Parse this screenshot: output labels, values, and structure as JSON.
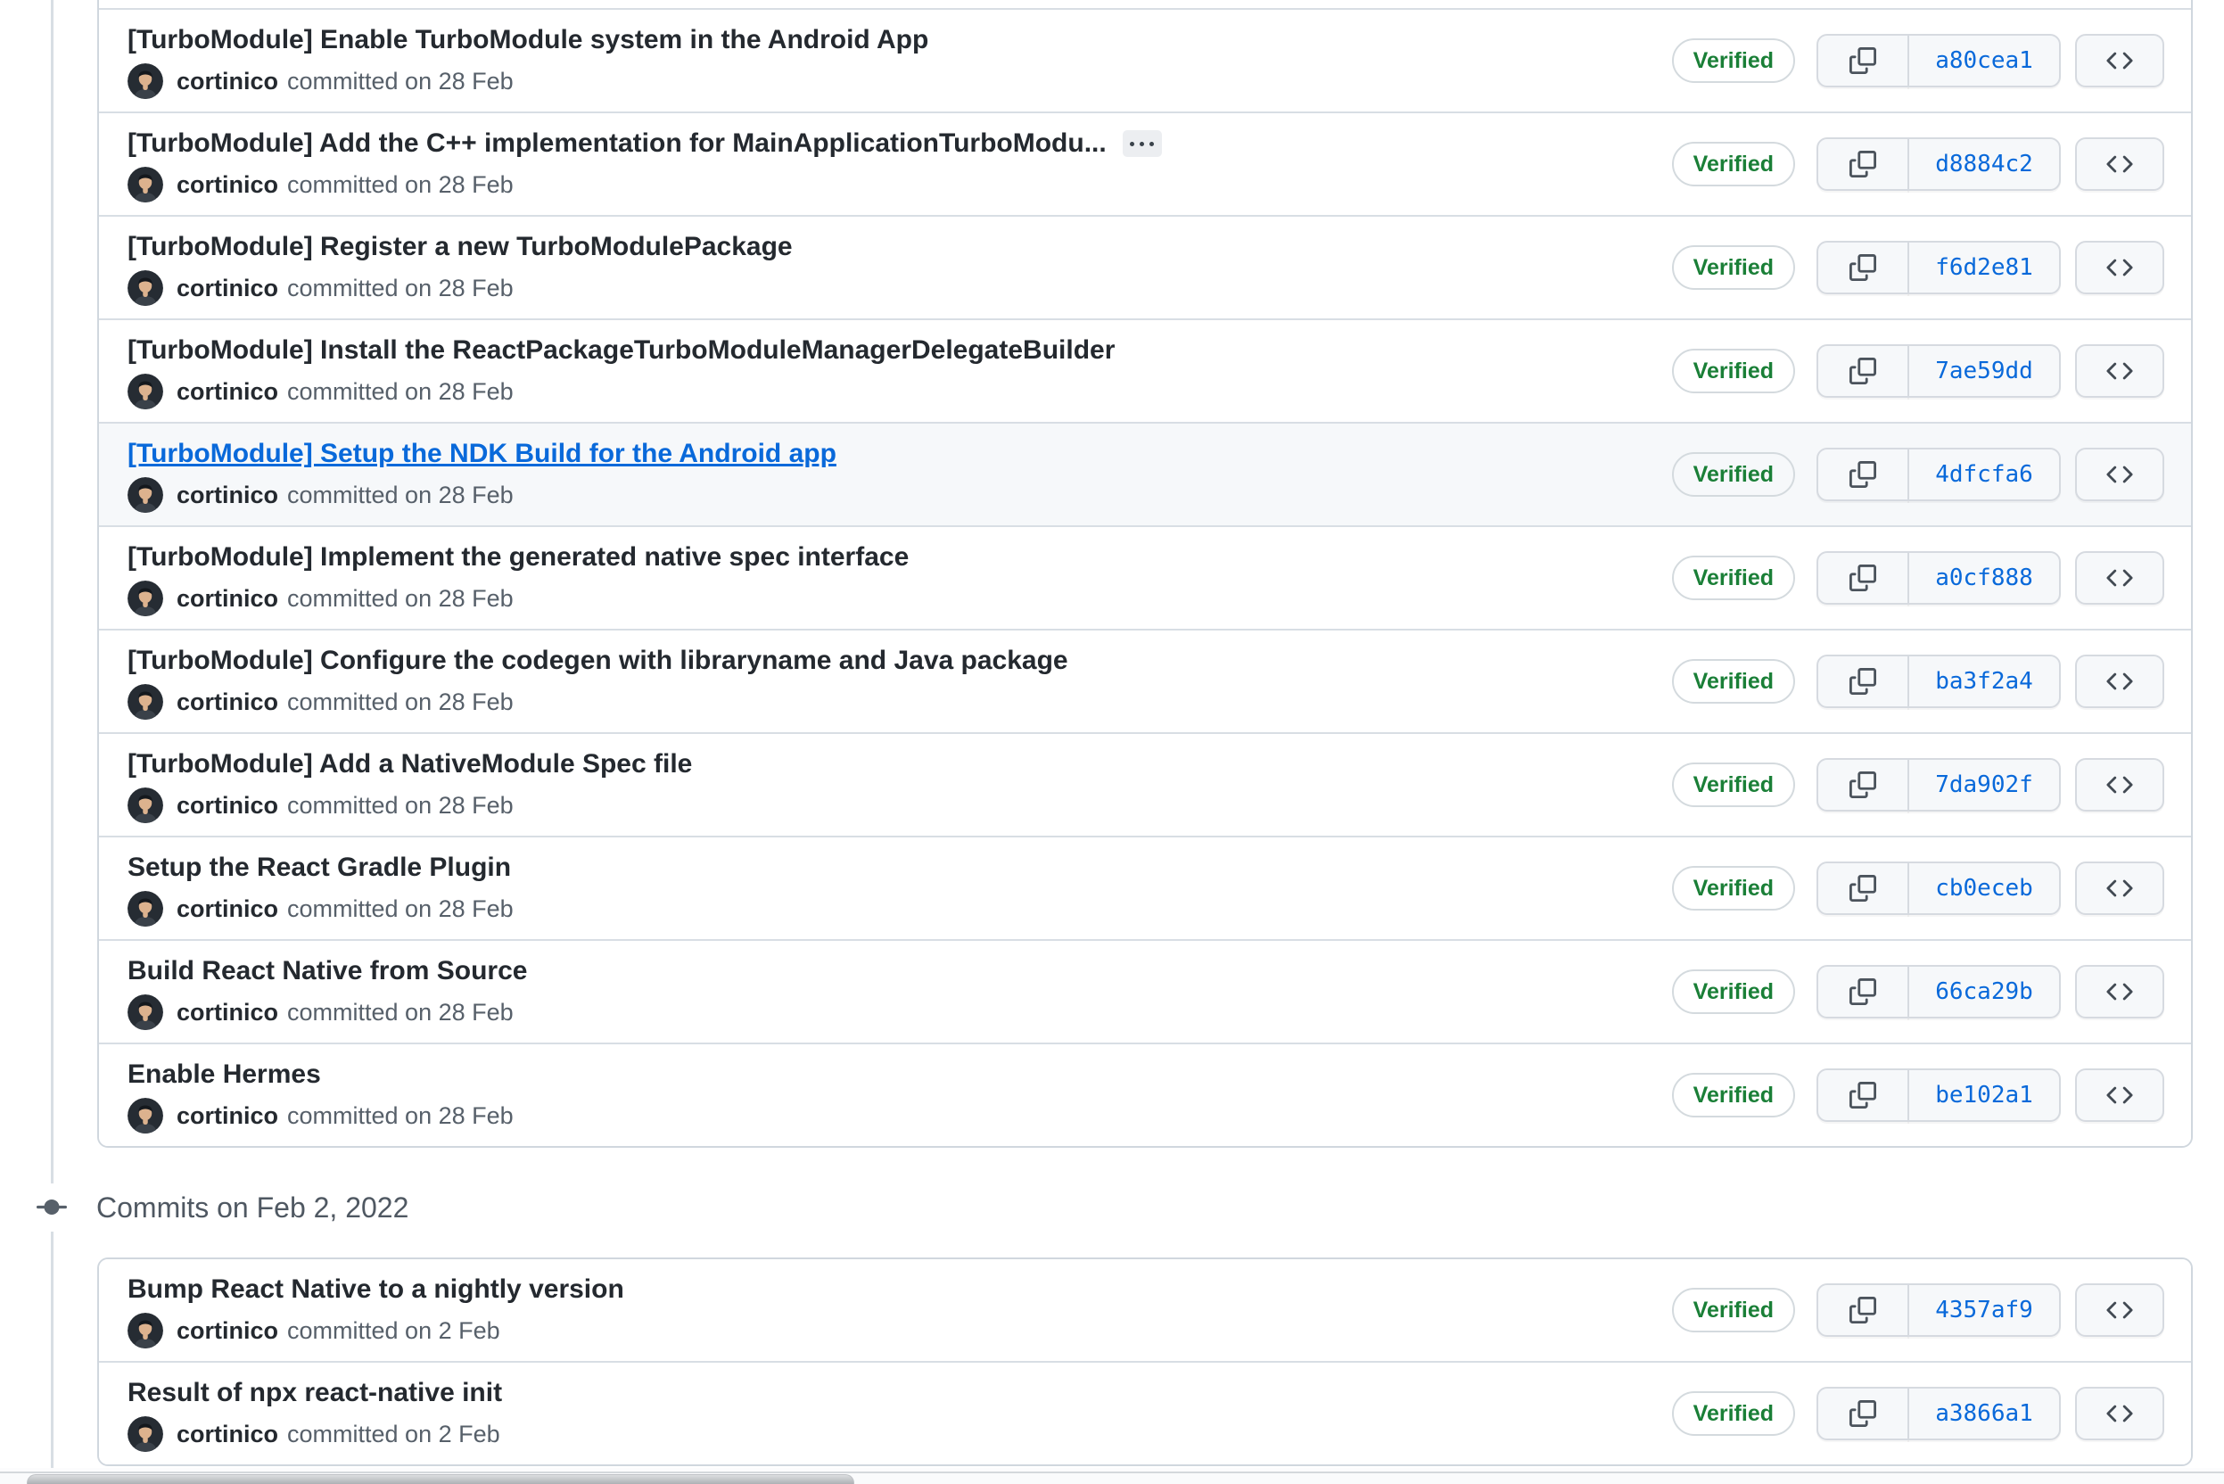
{
  "theme": {
    "link_blue": "#0969da",
    "verified_green": "#1a7f37",
    "text": "#24292f",
    "muted_text": "#57606a",
    "card_border": "#d0d7de",
    "row_highlight_bg": "#f6f8fa",
    "button_bg": "#f6f8fa"
  },
  "icons": {
    "copy": "copy-icon",
    "code": "code-icon",
    "git_commit": "git-commit-icon",
    "kebab": "kebab-horizontal-icon",
    "avatar": "user-avatar"
  },
  "scrollbar": {
    "orientation": "horizontal"
  },
  "groups": [
    {
      "heading": null,
      "commits": [
        {
          "title": "[TurboModule] Enable TurboModule system in the Android App",
          "author": "cortinico",
          "meta": "committed on 28 Feb",
          "hash": "a80cea1",
          "badge": "Verified",
          "truncated": false,
          "highlighted": false
        },
        {
          "title": "[TurboModule] Add the C++ implementation for MainApplicationTurboModu...",
          "author": "cortinico",
          "meta": "committed on 28 Feb",
          "hash": "d8884c2",
          "badge": "Verified",
          "truncated": true,
          "highlighted": false
        },
        {
          "title": "[TurboModule] Register a new TurboModulePackage",
          "author": "cortinico",
          "meta": "committed on 28 Feb",
          "hash": "f6d2e81",
          "badge": "Verified",
          "truncated": false,
          "highlighted": false
        },
        {
          "title": "[TurboModule] Install the ReactPackageTurboModuleManagerDelegateBuilder",
          "author": "cortinico",
          "meta": "committed on 28 Feb",
          "hash": "7ae59dd",
          "badge": "Verified",
          "truncated": false,
          "highlighted": false
        },
        {
          "title": "[TurboModule] Setup the NDK Build for the Android app",
          "author": "cortinico",
          "meta": "committed on 28 Feb",
          "hash": "4dfcfa6",
          "badge": "Verified",
          "truncated": false,
          "highlighted": true
        },
        {
          "title": "[TurboModule] Implement the generated native spec interface",
          "author": "cortinico",
          "meta": "committed on 28 Feb",
          "hash": "a0cf888",
          "badge": "Verified",
          "truncated": false,
          "highlighted": false
        },
        {
          "title": "[TurboModule] Configure the codegen with libraryname and Java package",
          "author": "cortinico",
          "meta": "committed on 28 Feb",
          "hash": "ba3f2a4",
          "badge": "Verified",
          "truncated": false,
          "highlighted": false
        },
        {
          "title": "[TurboModule] Add a NativeModule Spec file",
          "author": "cortinico",
          "meta": "committed on 28 Feb",
          "hash": "7da902f",
          "badge": "Verified",
          "truncated": false,
          "highlighted": false
        },
        {
          "title": "Setup the React Gradle Plugin",
          "author": "cortinico",
          "meta": "committed on 28 Feb",
          "hash": "cb0eceb",
          "badge": "Verified",
          "truncated": false,
          "highlighted": false
        },
        {
          "title": "Build React Native from Source",
          "author": "cortinico",
          "meta": "committed on 28 Feb",
          "hash": "66ca29b",
          "badge": "Verified",
          "truncated": false,
          "highlighted": false
        },
        {
          "title": "Enable Hermes",
          "author": "cortinico",
          "meta": "committed on 28 Feb",
          "hash": "be102a1",
          "badge": "Verified",
          "truncated": false,
          "highlighted": false
        }
      ]
    },
    {
      "heading": "Commits on Feb 2, 2022",
      "commits": [
        {
          "title": "Bump React Native to a nightly version",
          "author": "cortinico",
          "meta": "committed on 2 Feb",
          "hash": "4357af9",
          "badge": "Verified",
          "truncated": false,
          "highlighted": false
        },
        {
          "title": "Result of npx react-native init",
          "author": "cortinico",
          "meta": "committed on 2 Feb",
          "hash": "a3866a1",
          "badge": "Verified",
          "truncated": false,
          "highlighted": false
        }
      ]
    }
  ]
}
